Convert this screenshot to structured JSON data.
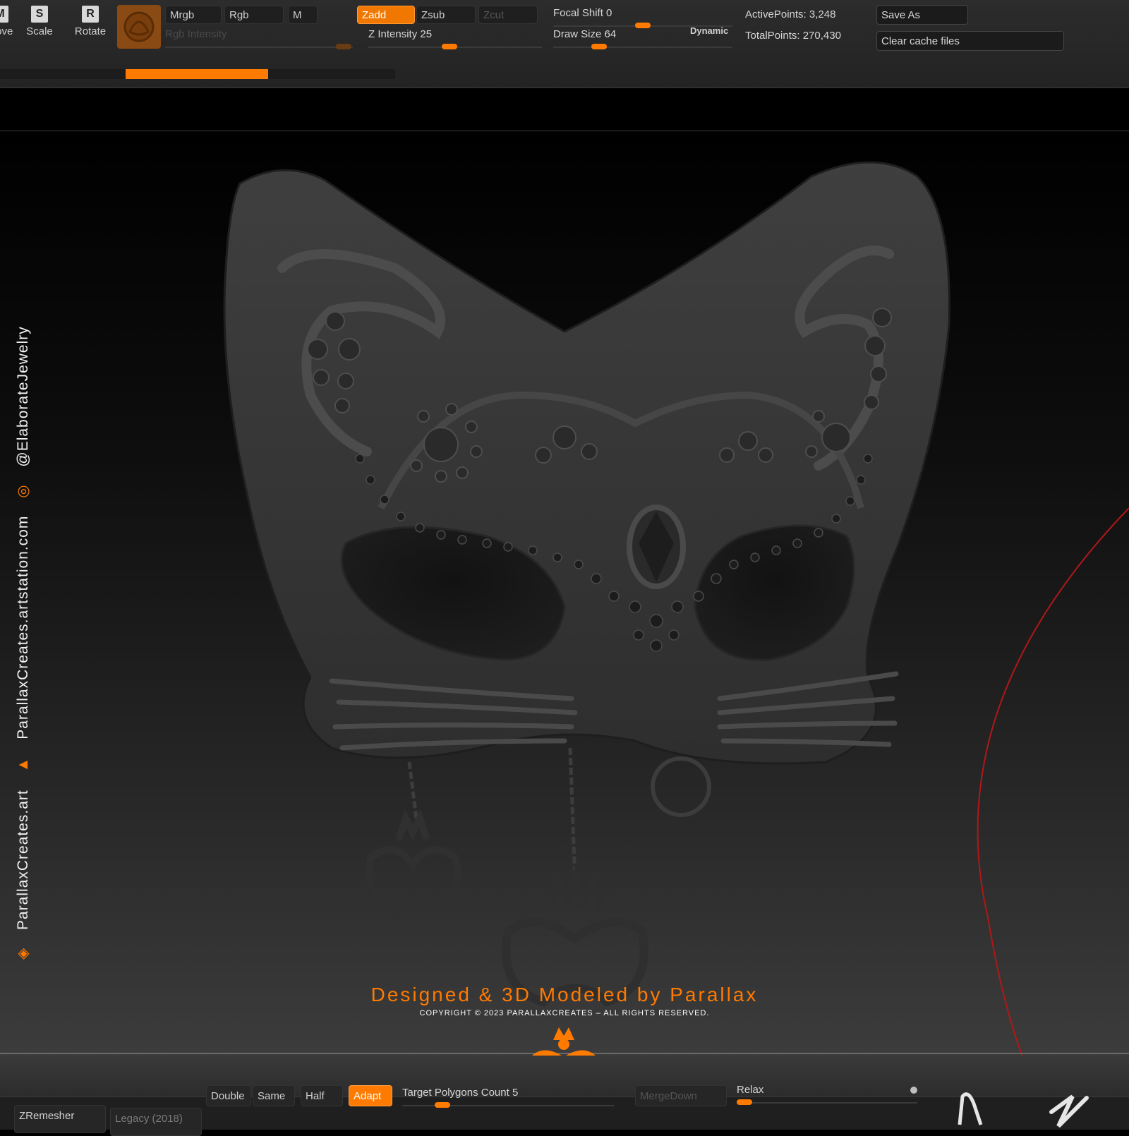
{
  "toolbar": {
    "tools": [
      {
        "key": "M",
        "label": "Move"
      },
      {
        "key": "S",
        "label": "Scale"
      },
      {
        "key": "R",
        "label": "Rotate"
      }
    ],
    "color_modes": {
      "mrgb": "Mrgb",
      "rgb": "Rgb",
      "m": "M"
    },
    "rgb_intensity_label": "Rgb Intensity",
    "z_modes": {
      "zadd": "Zadd",
      "zsub": "Zsub",
      "zcut": "Zcut"
    },
    "z_intensity": {
      "label": "Z Intensity",
      "value": "25"
    },
    "focal_shift": {
      "label": "Focal Shift",
      "value": "0"
    },
    "draw_size": {
      "label": "Draw Size",
      "value": "64"
    },
    "dynamic_label": "Dynamic",
    "active_points": "ActivePoints: 3,248",
    "total_points": "TotalPoints: 270,430",
    "save_as": "Save As",
    "clear_cache": "Clear cache files"
  },
  "sidebar_credits": {
    "site": "ParallaxCreates.art",
    "artstation": "ParallaxCreates.artstation.com",
    "instagram": "@ElaborateJewelry"
  },
  "credits": {
    "designed_by": "Designed & 3D Modeled by Parallax",
    "copyright": "COPYRIGHT © 2023 PARALLAXCREATES – ALL RIGHTS RESERVED.",
    "logo_mark": "®"
  },
  "bottom_bar": {
    "zremesher": "ZRemesher",
    "legacy": "Legacy (2018)",
    "double": "Double",
    "same": "Same",
    "half": "Half",
    "adapt": "Adapt",
    "target_polygons": {
      "label": "Target Polygons Count",
      "value": "5"
    },
    "merge_down": "MergeDown",
    "relax": "Relax"
  },
  "colors": {
    "accent": "#ff7a00",
    "background": "#000000",
    "panel": "#2a2a2a",
    "mask": "#3a3a3a",
    "guide_line": "#b01818"
  }
}
